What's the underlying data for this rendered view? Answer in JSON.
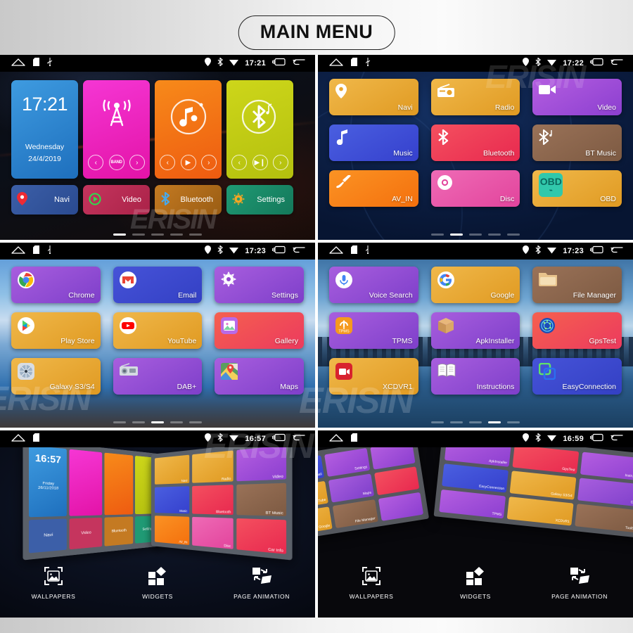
{
  "header": {
    "title": "MAIN MENU"
  },
  "watermark": "ERISIN",
  "statusbar": {
    "icons_left": [
      "home-icon",
      "sd-card-icon",
      "usb-icon"
    ],
    "icons_right": [
      "gps-icon",
      "bluetooth-icon",
      "wifi-icon"
    ],
    "nav_icons": [
      "recents-icon",
      "back-icon"
    ]
  },
  "screens": [
    {
      "id": "home-widgets",
      "time": "17:21",
      "wallpaper": "dark-abstract",
      "active_dot": 0,
      "dot_count": 5,
      "widgets": [
        {
          "name": "clock-widget",
          "time": "17:21",
          "day": "Wednesday",
          "date": "24/4/2019",
          "color": "#3e9be0"
        },
        {
          "name": "radio-widget",
          "icon": "radio-tower-icon",
          "color": "#f536d4",
          "controls": [
            "prev",
            "BAND",
            "next"
          ]
        },
        {
          "name": "music-widget",
          "icon": "music-note-icon",
          "color": "#f78a1a",
          "controls": [
            "prev",
            "play",
            "next"
          ]
        },
        {
          "name": "bluetooth-music-widget",
          "icon": "bluetooth-note-icon",
          "color": "#cdd61a",
          "controls": [
            "prev",
            "play-pause",
            "next"
          ]
        }
      ],
      "shortcuts": [
        {
          "label": "Navi",
          "icon": "map-pin-icon",
          "color": "#3c5fa8"
        },
        {
          "label": "Video",
          "icon": "play-circle-icon",
          "color": "#c5355e"
        },
        {
          "label": "Bluetooth",
          "icon": "bluetooth-icon",
          "color": "#c47a22"
        },
        {
          "label": "Settings",
          "icon": "gear-sun-icon",
          "color": "#1f9a74"
        }
      ]
    },
    {
      "id": "apps-page-2",
      "time": "17:22",
      "wallpaper": "navy-circles",
      "active_dot": 1,
      "dot_count": 5,
      "apps": [
        {
          "label": "Navi",
          "icon": "map-pin-icon",
          "style": "g-orange"
        },
        {
          "label": "Radio",
          "icon": "radio-icon",
          "style": "g-orange"
        },
        {
          "label": "Video",
          "icon": "video-camera-icon",
          "style": "g-purple"
        },
        {
          "label": "Music",
          "icon": "music-note-icon",
          "style": "g-blue"
        },
        {
          "label": "Bluetooth",
          "icon": "bluetooth-icon",
          "style": "g-red"
        },
        {
          "label": "BT Music",
          "icon": "bluetooth-note-icon",
          "style": "g-brown"
        },
        {
          "label": "AV_IN",
          "icon": "av-cable-icon",
          "style": "g-orange2"
        },
        {
          "label": "Disc",
          "icon": "disc-icon",
          "style": "g-pink"
        },
        {
          "label": "OBD",
          "icon": "obd-icon",
          "style": "g-orange"
        }
      ]
    },
    {
      "id": "apps-page-3",
      "time": "17:23",
      "wallpaper": "sea-coast",
      "active_dot": 2,
      "dot_count": 5,
      "apps": [
        {
          "label": "Chrome",
          "icon": "chrome-icon",
          "style": "g-purple2"
        },
        {
          "label": "Email",
          "icon": "gmail-icon",
          "style": "g-indigo"
        },
        {
          "label": "Settings",
          "icon": "gear-icon",
          "style": "g-purple2"
        },
        {
          "label": "Play Store",
          "icon": "play-store-icon",
          "style": "g-orange"
        },
        {
          "label": "YouTube",
          "icon": "youtube-icon",
          "style": "g-orange"
        },
        {
          "label": "Gallery",
          "icon": "gallery-icon",
          "style": "g-salmon"
        },
        {
          "label": "Galaxy S3/S4",
          "icon": "galaxy-icon",
          "style": "g-orange"
        },
        {
          "label": "DAB+",
          "icon": "dab-radio-icon",
          "style": "g-purple2"
        },
        {
          "label": "Maps",
          "icon": "maps-icon",
          "style": "g-purple2"
        }
      ]
    },
    {
      "id": "apps-page-4",
      "time": "17:23",
      "wallpaper": "city-skyline",
      "active_dot": 3,
      "dot_count": 5,
      "apps": [
        {
          "label": "Voice Search",
          "icon": "microphone-icon",
          "style": "g-purple2"
        },
        {
          "label": "Google",
          "icon": "google-icon",
          "style": "g-orange"
        },
        {
          "label": "File Manager",
          "icon": "folder-icon",
          "style": "g-brown"
        },
        {
          "label": "TPMS",
          "icon": "tpms-icon",
          "style": "g-purple2"
        },
        {
          "label": "ApkInstaller",
          "icon": "package-box-icon",
          "style": "g-purple2"
        },
        {
          "label": "GpsTest",
          "icon": "gps-globe-icon",
          "style": "g-salmon"
        },
        {
          "label": "XCDVR1",
          "icon": "dashcam-icon",
          "style": "g-orange"
        },
        {
          "label": "Instructions",
          "icon": "book-icon",
          "style": "g-purple2"
        },
        {
          "label": "EasyConnection",
          "icon": "mirror-link-icon",
          "style": "g-indigo"
        }
      ]
    },
    {
      "id": "page-animation-left",
      "time": "16:57",
      "wallpaper": "night",
      "widget_preview": {
        "clock_time": "16:57",
        "clock_day": "Friday",
        "clock_date": "26/11/2018",
        "shortcuts": [
          "Navi",
          "Video",
          "Bluetooth",
          "Settings"
        ]
      },
      "apps_preview": [
        "Navi",
        "Radio",
        "Video",
        "Music",
        "Bluetooth",
        "BT Music",
        "AV_IN",
        "Disc",
        "Car Info"
      ],
      "bottom_bar": [
        {
          "label": "WALLPAPERS",
          "icon": "wallpaper-icon"
        },
        {
          "label": "WIDGETS",
          "icon": "widgets-icon"
        },
        {
          "label": "PAGE ANIMATION",
          "icon": "page-animation-icon"
        }
      ]
    },
    {
      "id": "page-animation-right",
      "time": "16:59",
      "wallpaper": "black",
      "left_preview": [
        "Email",
        "Settings",
        "YouTube",
        "Maps",
        "Google",
        "File Manager"
      ],
      "right_preview": [
        "ApkInstaller",
        "GpsTest",
        "Instructions",
        "EasyConnection",
        "Galaxy S3/S4",
        "DAB+",
        "TPMS",
        "XCDVR1",
        "Toolbox"
      ],
      "bottom_bar": [
        {
          "label": "WALLPAPERS",
          "icon": "wallpaper-icon"
        },
        {
          "label": "WIDGETS",
          "icon": "widgets-icon"
        },
        {
          "label": "PAGE ANIMATION",
          "icon": "page-animation-icon"
        }
      ]
    }
  ]
}
